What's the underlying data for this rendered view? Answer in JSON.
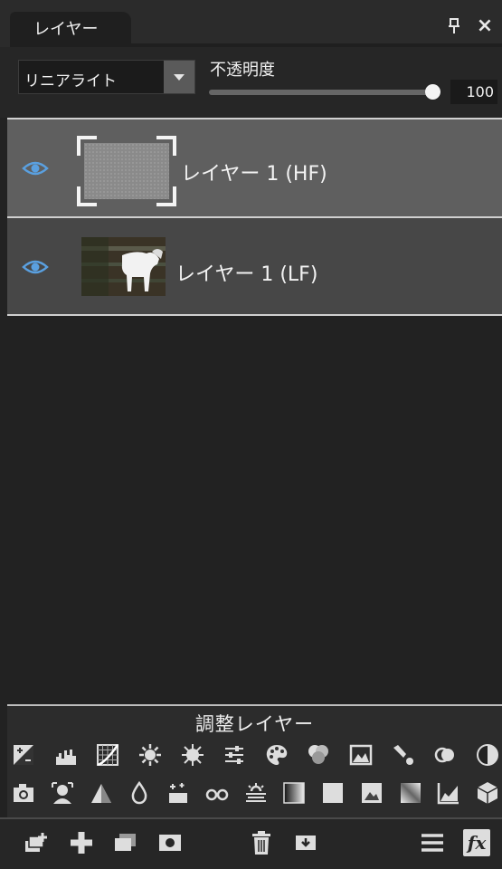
{
  "tab": {
    "label": "レイヤー"
  },
  "window_controls": {
    "pin": "pin-icon",
    "close_label": "×"
  },
  "blend_mode": {
    "value": "リニアライト"
  },
  "opacity": {
    "label": "不透明度",
    "value": "100",
    "level": 1.0
  },
  "layers": [
    {
      "name": "レイヤー 1 (HF)",
      "visible": true,
      "selected": true,
      "thumbnail": "gray-noise"
    },
    {
      "name": "レイヤー 1 (LF)",
      "visible": true,
      "selected": false,
      "thumbnail": "white-horse-photo"
    }
  ],
  "adjustment_layers": {
    "title": "調整レイヤー",
    "row1": [
      "exposure-icon",
      "levels-icon",
      "curves-icon",
      "brightness-icon",
      "contrast-icon",
      "sliders-icon",
      "palette-icon",
      "color-balance-icon",
      "photo-filter-icon",
      "selective-color-icon",
      "channel-mixer-icon",
      "invert-icon"
    ],
    "row2": [
      "camera-icon",
      "portrait-icon",
      "threshold-icon",
      "drop-icon",
      "sparkle-icon",
      "glasses-icon",
      "haze-icon",
      "gradient-map-icon",
      "solid-fill-icon",
      "image-fill-icon",
      "gradient-fill-icon",
      "histogram-icon",
      "cube-icon"
    ]
  },
  "toolbar": {
    "items": [
      "new-group-icon",
      "add-layer-icon",
      "duplicate-layer-icon",
      "mask-icon",
      "trash-icon",
      "merge-icon",
      "menu-icon",
      "fx-icon"
    ],
    "fx_label": "fx"
  },
  "colors": {
    "selected_row": "#5f5f5f",
    "row": "#474747",
    "eye": "#5aa0e0",
    "background": "#222222"
  }
}
